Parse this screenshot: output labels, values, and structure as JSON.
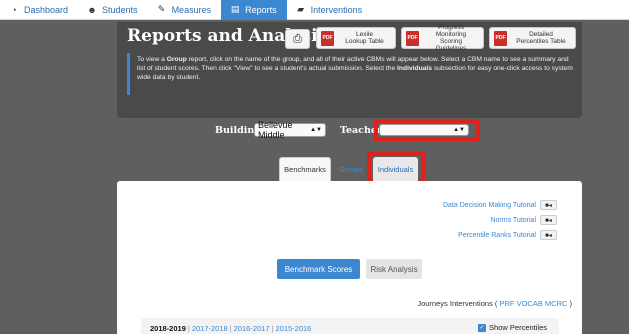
{
  "nav": {
    "items": [
      {
        "label": "Dashboard",
        "icon": "dashboard-icon",
        "glyph": "◔"
      },
      {
        "label": "Students",
        "icon": "students-icon",
        "glyph": "☻"
      },
      {
        "label": "Measures",
        "icon": "pencil-icon",
        "glyph": "✎"
      },
      {
        "label": "Reports",
        "icon": "bar-chart-icon",
        "glyph": "▤"
      },
      {
        "label": "Interventions",
        "icon": "book-icon",
        "glyph": "▰"
      }
    ],
    "active": "Reports"
  },
  "header": {
    "title": "Reports and Analysis",
    "print_glyph": "⎙",
    "buttons": [
      {
        "label_line1": "Lexile",
        "label_line2": "Lookup Table"
      },
      {
        "label_line1": "Progress Monitoring",
        "label_line2": "Scoring Guidelines"
      },
      {
        "label_line1": "Detailed",
        "label_line2": "Percentiles Table"
      }
    ],
    "pdf_glyph": "PDF",
    "info": {
      "part1": "To view a ",
      "bold1": "Group",
      "part2": " report, click on the name of the group, and all of their active CBMs will appear below. Select a CBM name to see a summary and list of student scores. Then click \"View\" to see a student's actual submission. Select the ",
      "bold2": "Individuals",
      "part3": " subsection for easy one-click access to system wide data by student."
    }
  },
  "filters": {
    "building_label": "Building:",
    "building_value": "Bellevue Middle",
    "teacher_label": "Teacher:",
    "teacher_value": "",
    "arrows": "▲▼"
  },
  "tabs": [
    "Benchmarks",
    "Groups",
    "Individuals"
  ],
  "tutorials": [
    "Data Decision Making Tutorial",
    "Norms Tutorial",
    "Percentile Ranks Tutorial"
  ],
  "camera_glyph": "■◂",
  "buttons": {
    "benchmark_scores": "Benchmark Scores",
    "risk_analysis": "Risk Analysis"
  },
  "journeys": {
    "prefix": "Journeys Interventions (",
    "links": "PRF VOCAB MCRC",
    "suffix": ")"
  },
  "years": {
    "current": "2018-2019",
    "others": [
      "2017-2018",
      "2016-2017",
      "2015-2016"
    ],
    "separator": "|"
  },
  "show_percentiles": {
    "label": "Show Percentiles",
    "checked": true,
    "check_glyph": "✓"
  },
  "colors": {
    "accent": "#3c88d0",
    "highlight": "#e0201a",
    "panel": "#4a4a4a"
  }
}
